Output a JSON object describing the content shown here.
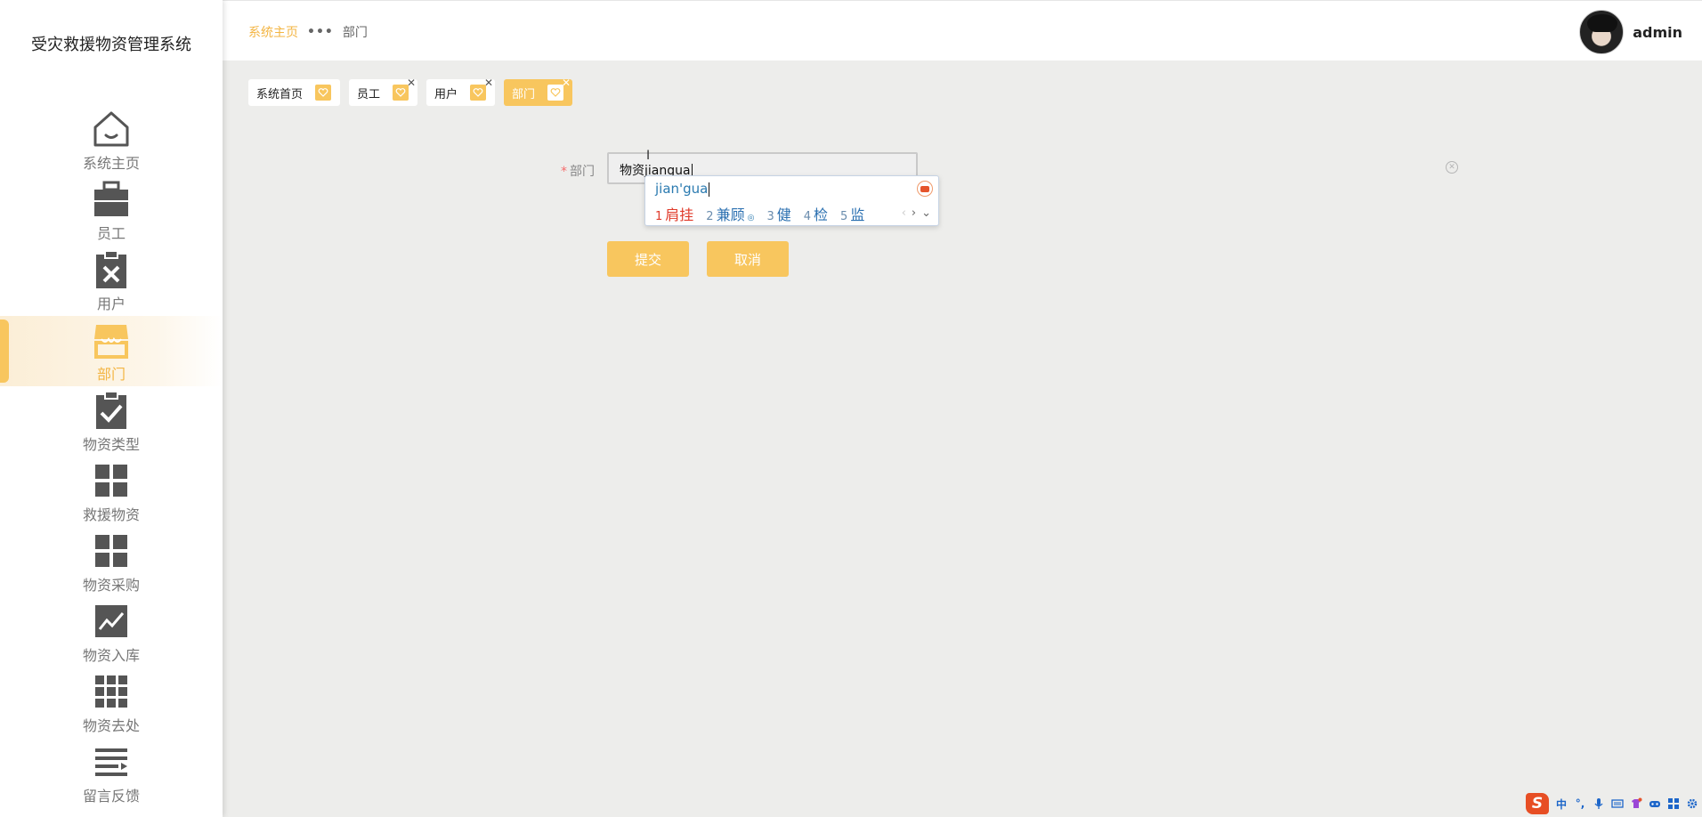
{
  "app": {
    "title": "受灾救援物资管理系统"
  },
  "sidebar": {
    "items": [
      {
        "label": "系统主页",
        "icon": "house-icon",
        "active": false
      },
      {
        "label": "员工",
        "icon": "briefcase-icon",
        "active": false
      },
      {
        "label": "用户",
        "icon": "clipboard-x-icon",
        "active": false
      },
      {
        "label": "部门",
        "icon": "store-icon",
        "active": true
      },
      {
        "label": "物资类型",
        "icon": "clipboard-check-icon",
        "active": false
      },
      {
        "label": "救援物资",
        "icon": "grid-four-icon",
        "active": false
      },
      {
        "label": "物资采购",
        "icon": "grid-four-icon",
        "active": false
      },
      {
        "label": "物资入库",
        "icon": "trend-chart-icon",
        "active": false
      },
      {
        "label": "物资去处",
        "icon": "grid-nine-icon",
        "active": false
      },
      {
        "label": "留言反馈",
        "icon": "list-icon",
        "active": false
      }
    ]
  },
  "header": {
    "breadcrumb": {
      "home": "系统主页",
      "separator": "•••",
      "current": "部门"
    },
    "user": {
      "name": "admin"
    }
  },
  "tabs": [
    {
      "label": "系统首页",
      "closable": false,
      "active": false
    },
    {
      "label": "员工",
      "closable": true,
      "active": false
    },
    {
      "label": "用户",
      "closable": true,
      "active": false
    },
    {
      "label": "部门",
      "closable": true,
      "active": true
    }
  ],
  "form": {
    "field_label": "部门",
    "required_mark": "*",
    "input_value": "物资jiangua",
    "submit_label": "提交",
    "cancel_label": "取消"
  },
  "ime": {
    "pinyin": "jian'gua",
    "candidates": [
      {
        "num": "1",
        "word": "肩挂"
      },
      {
        "num": "2",
        "word": "兼顾"
      },
      {
        "num": "3",
        "word": "健"
      },
      {
        "num": "4",
        "word": "检"
      },
      {
        "num": "5",
        "word": "监"
      }
    ],
    "prev": "‹",
    "next": "›",
    "expand": "⌄"
  },
  "tray": {
    "ime_mode": "中",
    "ime_logo": "S"
  },
  "colors": {
    "accent": "#f8c65e",
    "accent_text": "#f3b543",
    "background": "#ededeb",
    "sidebar": "#ffffff"
  }
}
